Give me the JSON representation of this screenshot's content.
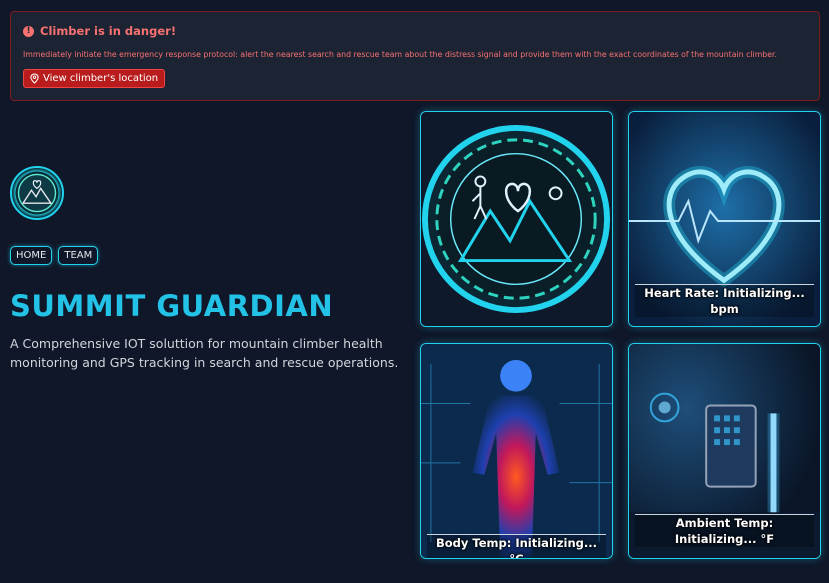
{
  "alert": {
    "title": "Climber is in danger!",
    "body": "Immediately initiate the emergency response protocol: alert the nearest search and rescue team about the distress signal and provide them with the exact coordinates of the mountain climber.",
    "button": "View climber's location"
  },
  "nav": {
    "home": "HOME",
    "team": "TEAM"
  },
  "hero": {
    "title": "SUMMIT GUARDIAN",
    "description": "A Comprehensive IOT soluttion for mountain climber health monitoring and GPS tracking in search and rescue operations."
  },
  "cards": {
    "heart": "Heart Rate: Initializing... bpm",
    "body": "Body Temp: Initializing... °C",
    "ambient": "Ambient Temp: Initializing... °F"
  },
  "colors": {
    "accent": "#22d3ee",
    "danger": "#f87171",
    "background": "#0f1729"
  }
}
